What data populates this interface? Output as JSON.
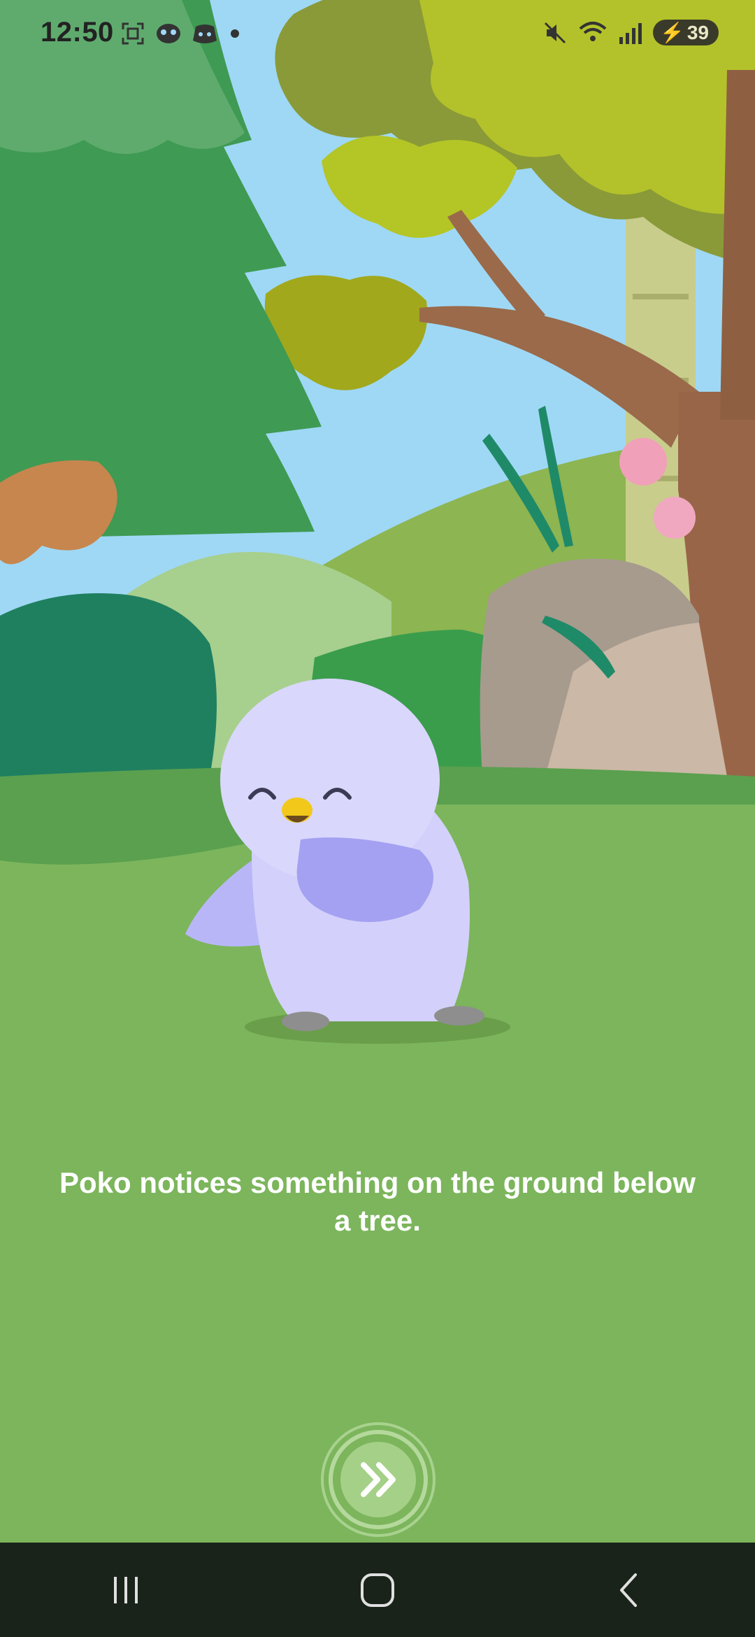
{
  "status_bar": {
    "time": "12:50",
    "battery_level": "39",
    "icons_left": [
      "screenshot-icon",
      "game-controller-icon",
      "discord-icon",
      "notification-dot-icon"
    ],
    "icons_right": [
      "mute-icon",
      "wifi-icon",
      "signal-icon",
      "battery-icon"
    ]
  },
  "story": {
    "character": "Poko",
    "text": "Poko notices something on the ground below a tree."
  },
  "controls": {
    "next_icon": "double-chevron-right-icon"
  },
  "nav_bar": {
    "buttons": [
      "recent-apps",
      "home",
      "back"
    ]
  },
  "colors": {
    "sky": "#9fd8f5",
    "grass": "#7cb55c",
    "poko_body": "#d3d1fb",
    "poko_wing": "#a4a1f2",
    "nav_background": "#19231a"
  }
}
